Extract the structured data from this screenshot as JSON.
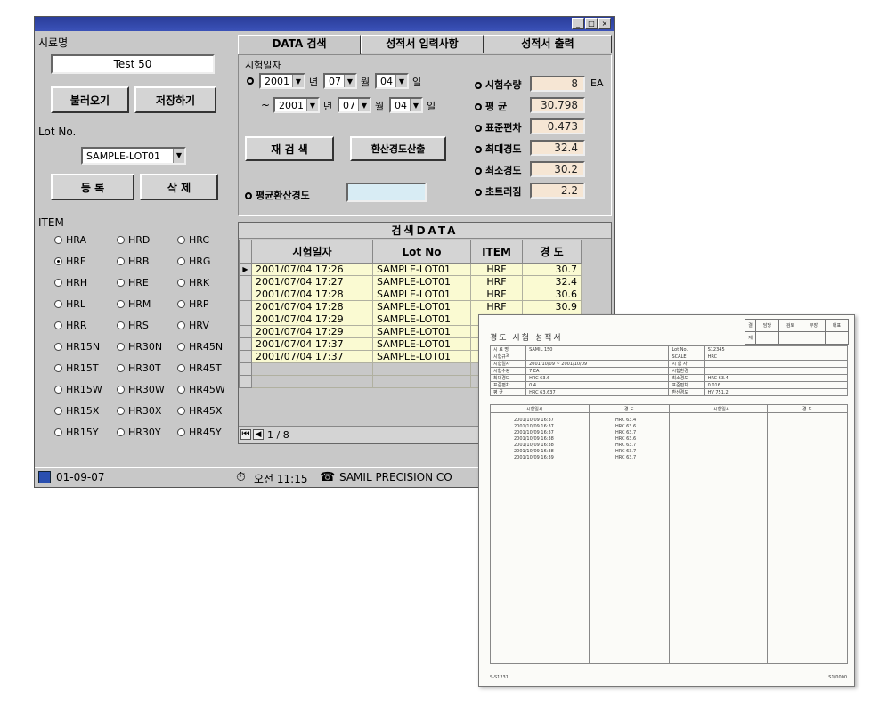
{
  "left": {
    "sample_name_label": "시료명",
    "sample_name_value": "Test 50",
    "load_button": "불러오기",
    "save_button": "저장하기",
    "lot_label": "Lot No.",
    "lot_value": "SAMPLE-LOT01",
    "register_button": "등 록",
    "delete_button": "삭 제",
    "item_label": "ITEM",
    "items": [
      [
        "HRA",
        "HRD",
        "HRC"
      ],
      [
        "HRF",
        "HRB",
        "HRG"
      ],
      [
        "HRH",
        "HRE",
        "HRK"
      ],
      [
        "HRL",
        "HRM",
        "HRP"
      ],
      [
        "HRR",
        "HRS",
        "HRV"
      ],
      [
        "HR15N",
        "HR30N",
        "HR45N"
      ],
      [
        "HR15T",
        "HR30T",
        "HR45T"
      ],
      [
        "HR15W",
        "HR30W",
        "HR45W"
      ],
      [
        "HR15X",
        "HR30X",
        "HR45X"
      ],
      [
        "HR15Y",
        "HR30Y",
        "HR45Y"
      ]
    ],
    "selected_item": "HRF"
  },
  "tabs": [
    "DATA 검색",
    "성적서 입력사항",
    "성적서 출력"
  ],
  "search": {
    "date_label": "시험일자",
    "from_year": "2001",
    "from_month": "07",
    "from_day": "04",
    "to_year": "2001",
    "to_month": "07",
    "to_day": "04",
    "year_suffix": "년",
    "month_suffix": "월",
    "day_suffix": "일",
    "tilde": "~",
    "research_button": "재 검 색",
    "convert_button": "환산경도산출",
    "avg_convert_label": "평균환산경도",
    "avg_convert_value": ""
  },
  "stats": [
    {
      "label": "시험수량",
      "value": "8",
      "unit": "EA"
    },
    {
      "label": "평       균",
      "value": "30.798",
      "unit": ""
    },
    {
      "label": "표준편차",
      "value": "0.473",
      "unit": ""
    },
    {
      "label": "최대경도",
      "value": "32.4",
      "unit": ""
    },
    {
      "label": "최소경도",
      "value": "30.2",
      "unit": ""
    },
    {
      "label": "초트러짐",
      "value": "2.2",
      "unit": ""
    }
  ],
  "grid": {
    "title": "검색DATA",
    "headers": [
      "시험일자",
      "Lot No",
      "ITEM",
      "경 도"
    ],
    "rows": [
      [
        "2001/07/04 17:26",
        "SAMPLE-LOT01",
        "HRF",
        "30.7"
      ],
      [
        "2001/07/04 17:27",
        "SAMPLE-LOT01",
        "HRF",
        "32.4"
      ],
      [
        "2001/07/04 17:28",
        "SAMPLE-LOT01",
        "HRF",
        "30.6"
      ],
      [
        "2001/07/04 17:28",
        "SAMPLE-LOT01",
        "HRF",
        "30.9"
      ],
      [
        "2001/07/04 17:29",
        "SAMPLE-LOT01",
        "HRF",
        ""
      ],
      [
        "2001/07/04 17:29",
        "SAMPLE-LOT01",
        "HRF",
        ""
      ],
      [
        "2001/07/04 17:37",
        "SAMPLE-LOT01",
        "HRF",
        ""
      ],
      [
        "2001/07/04 17:37",
        "SAMPLE-LOT01",
        "",
        ""
      ]
    ],
    "pager": "1 / 8"
  },
  "statusbar": {
    "date": "01-09-07",
    "time": "오전 11:15",
    "company": "SAMIL PRECISION CO"
  },
  "report": {
    "title": "경도 시험 성적서",
    "approval": [
      "결",
      "재",
      "담당",
      "검토",
      "부장",
      "대표"
    ],
    "info": [
      [
        "시 료 명",
        "SAMIL 150",
        "Lot No.",
        "S12345"
      ],
      [
        "시험규격",
        "",
        "SCALE",
        "HRC"
      ],
      [
        "시험일자",
        "2001/10/09 ~ 2001/10/09",
        "시 험 자",
        ""
      ],
      [
        "시험수량",
        "7 EA",
        "시험환경",
        ""
      ],
      [
        "최대경도",
        "HRC 63.6",
        "최소경도",
        "HRC 63.4"
      ],
      [
        "표준편차",
        "0.4",
        "표준편차",
        "0.016"
      ],
      [
        "평    균",
        "HRC 63.637",
        "환산경도",
        "HV 751.2"
      ]
    ],
    "measure_headers": [
      "시험일시",
      "경  도",
      "시험일시",
      "경  도"
    ],
    "measures": [
      [
        "2001/10/09 16:37",
        "HRC 63.4"
      ],
      [
        "2001/10/09 16:37",
        "HRC 63.6"
      ],
      [
        "2001/10/09 16:37",
        "HRC 63.7"
      ],
      [
        "2001/10/09 16:38",
        "HRC 63.6"
      ],
      [
        "2001/10/09 16:38",
        "HRC 63.7"
      ],
      [
        "2001/10/09 16:38",
        "HRC 63.7"
      ],
      [
        "2001/10/09 16:39",
        "HRC 63.7"
      ]
    ],
    "footer_left": "S-S1231",
    "footer_right": "S1/0000"
  }
}
